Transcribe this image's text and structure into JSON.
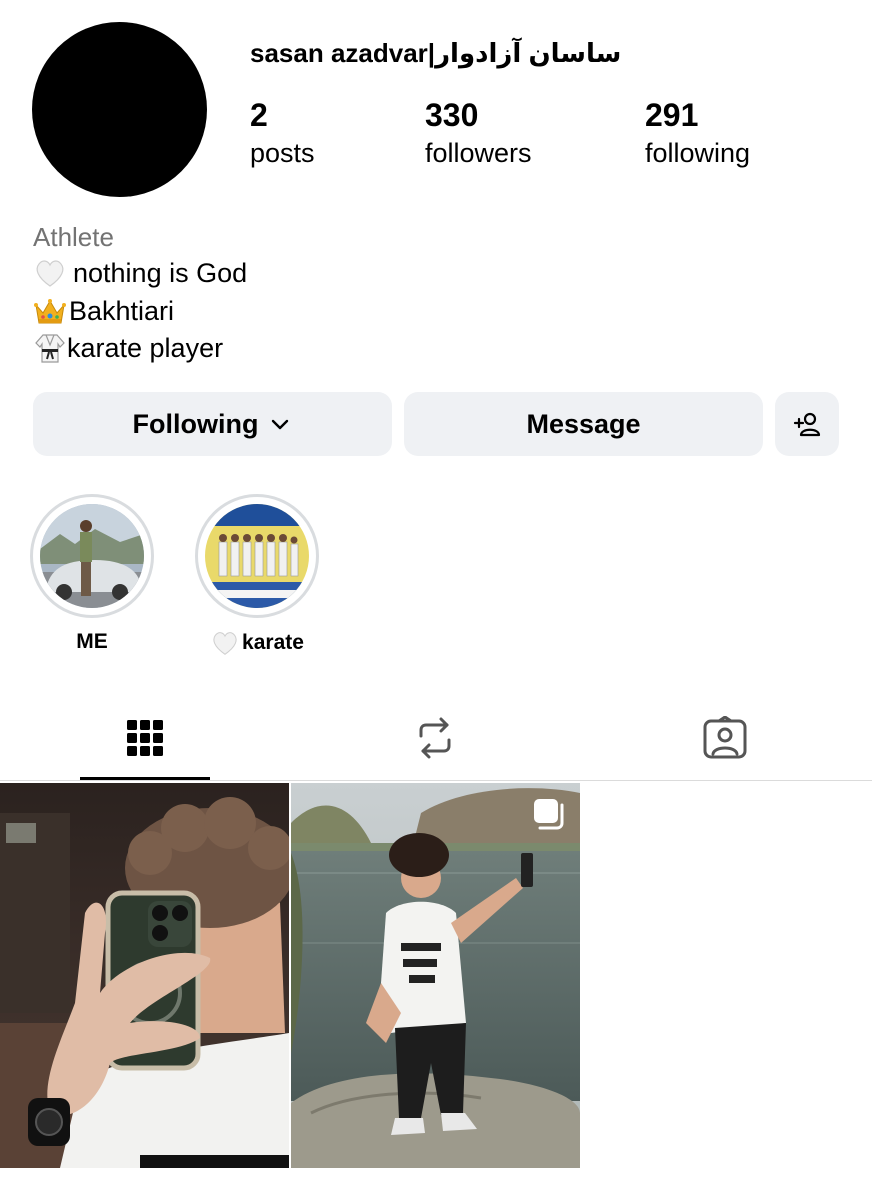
{
  "profile": {
    "username": "sasan azadvar|ساسان آزادوار",
    "stats": [
      {
        "value": "2",
        "label": "posts"
      },
      {
        "value": "330",
        "label": "followers"
      },
      {
        "value": "291",
        "label": "following"
      }
    ],
    "category": "Athlete",
    "bio": [
      {
        "icon": "white-heart-icon",
        "text": " nothing is God"
      },
      {
        "icon": "crown-icon",
        "text": "Bakhtiari"
      },
      {
        "icon": "karate-uniform-icon",
        "text": " karate player"
      }
    ]
  },
  "actions": {
    "following_label": "Following",
    "message_label": "Message",
    "add_person_icon": "add-person-icon"
  },
  "highlights": [
    {
      "label": "ME"
    },
    {
      "label": "karate",
      "icon": "white-heart-icon"
    }
  ],
  "tabs": [
    {
      "icon": "grid-icon",
      "active": true
    },
    {
      "icon": "reels-repost-icon",
      "active": false
    },
    {
      "icon": "tagged-person-icon",
      "active": false
    }
  ],
  "posts": [
    {
      "kind": "mirror-selfie"
    },
    {
      "kind": "lakeside-photo",
      "badge_icon": "multi-photo-icon"
    }
  ]
}
